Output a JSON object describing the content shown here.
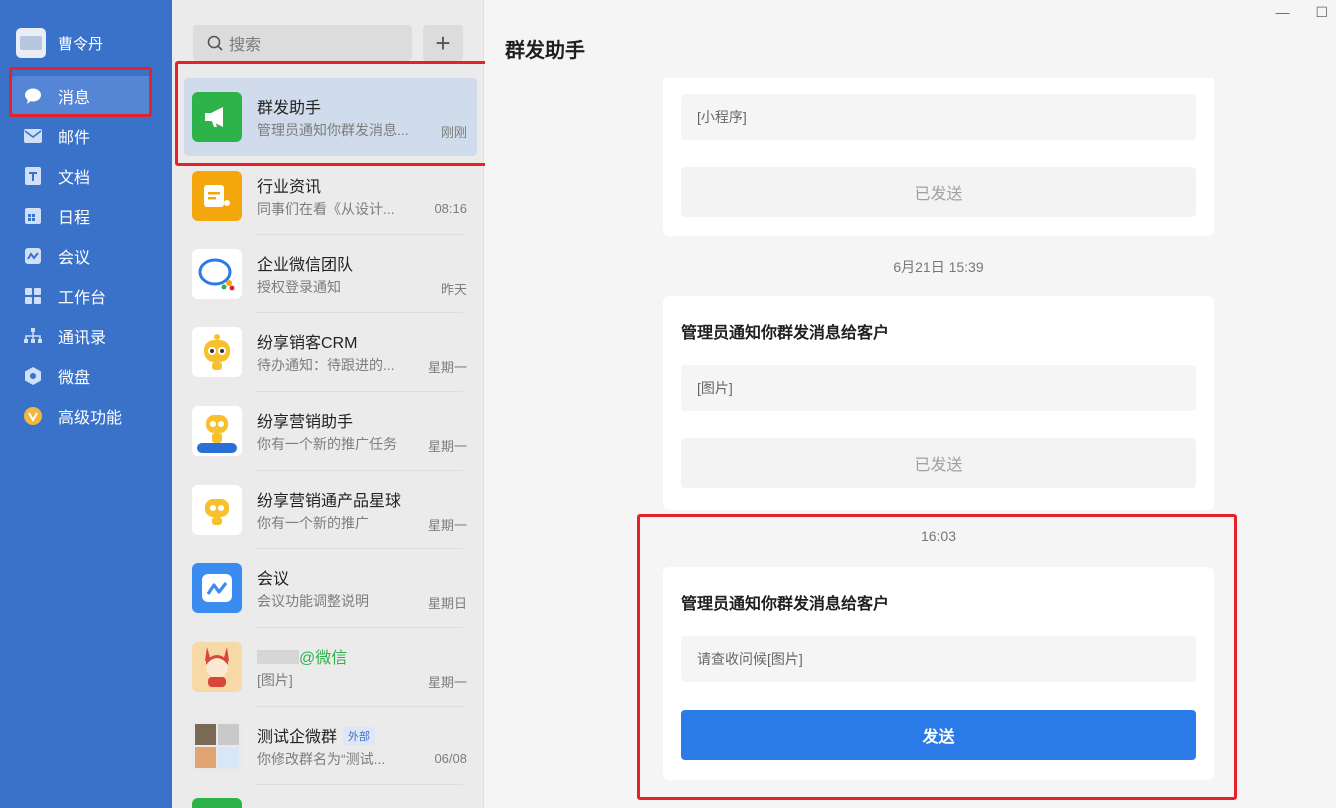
{
  "profile": {
    "name": "曹令丹"
  },
  "nav": [
    {
      "label": "消息",
      "icon": "chat-bubble-icon"
    },
    {
      "label": "邮件",
      "icon": "mail-icon"
    },
    {
      "label": "文档",
      "icon": "document-icon"
    },
    {
      "label": "日程",
      "icon": "calendar-icon"
    },
    {
      "label": "会议",
      "icon": "meeting-icon"
    },
    {
      "label": "工作台",
      "icon": "grid-icon"
    },
    {
      "label": "通讯录",
      "icon": "org-chart-icon"
    },
    {
      "label": "微盘",
      "icon": "drive-icon"
    },
    {
      "label": "高级功能",
      "icon": "premium-icon"
    }
  ],
  "search": {
    "placeholder": "搜索"
  },
  "add_label": "+",
  "conversations": [
    {
      "name": "群发助手",
      "preview": "管理员通知你群发消息...",
      "time": "刚刚"
    },
    {
      "name": "行业资讯",
      "preview": "同事们在看《从设计...",
      "time": "08:16"
    },
    {
      "name": "企业微信团队",
      "preview": "授权登录通知",
      "time": "昨天"
    },
    {
      "name": "纷享销客CRM",
      "preview": "待办通知：待跟进的...",
      "time": "星期一"
    },
    {
      "name": "纷享营销助手",
      "preview": "你有一个新的推广任务",
      "time": "星期一"
    },
    {
      "name": "纷享营销通产品星球",
      "preview": "你有一个新的推广",
      "time": "星期一"
    },
    {
      "name": "会议",
      "preview": "会议功能调整说明",
      "time": "星期日"
    },
    {
      "name": "@微信",
      "preview": "[图片]",
      "time": "星期一"
    },
    {
      "name": "测试企微群",
      "tag": "外部",
      "preview": "你修改群名为“测试...",
      "time": "06/08"
    }
  ],
  "chat": {
    "title": "群发助手",
    "card1": {
      "field": "[小程序]",
      "status": "已发送"
    },
    "time1": "6月21日 15:39",
    "card2": {
      "title": "管理员通知你群发消息给客户",
      "field": "[图片]",
      "status": "已发送"
    },
    "time2": "16:03",
    "card3": {
      "title": "管理员通知你群发消息给客户",
      "field": "请查收问候[图片]",
      "button": "发送"
    }
  },
  "colors": {
    "sidebar": "#3a72c9",
    "accent": "#2a7ae8",
    "highlight": "#e8202a"
  }
}
